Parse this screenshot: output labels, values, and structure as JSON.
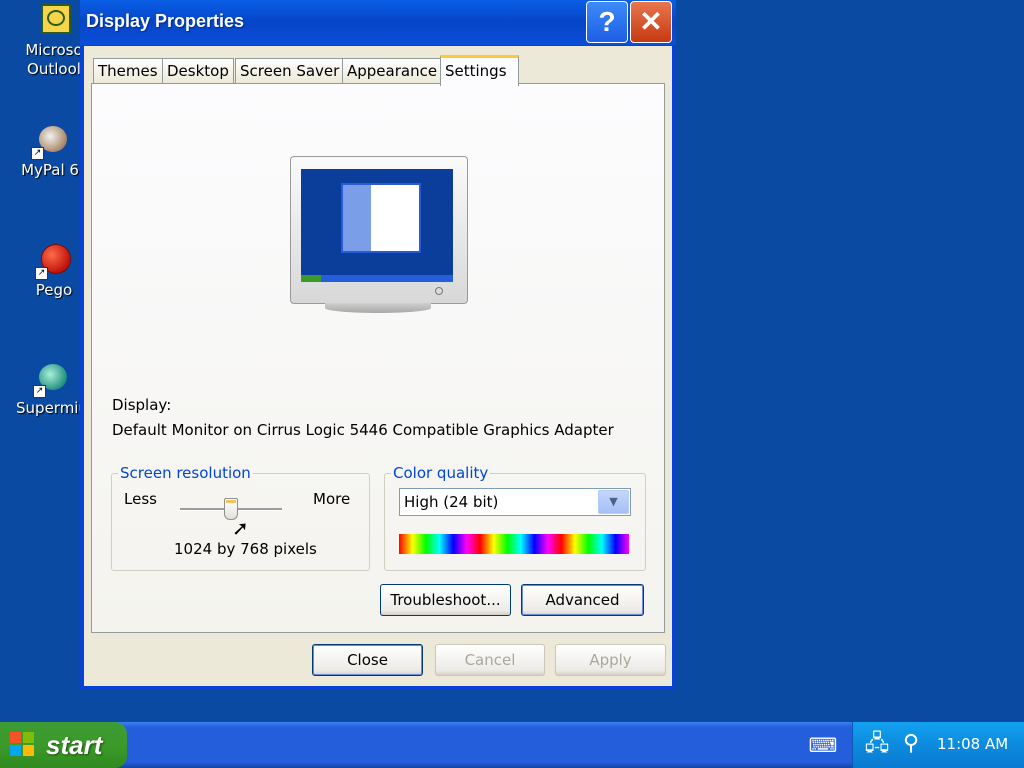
{
  "desktop": {
    "icons": [
      {
        "label": "Microso",
        "label2": "Outlool"
      },
      {
        "label": "MyPal 6"
      },
      {
        "label": "Pego"
      },
      {
        "label": "Supermiu"
      }
    ]
  },
  "window": {
    "title": "Display Properties",
    "help_glyph": "?",
    "close_glyph": "✕",
    "tabs": [
      {
        "label": "Themes"
      },
      {
        "label": "Desktop"
      },
      {
        "label": "Screen Saver"
      },
      {
        "label": "Appearance"
      },
      {
        "label": "Settings"
      }
    ],
    "active_tab": "Settings",
    "display_label": "Display:",
    "display_value": "Default Monitor on Cirrus Logic 5446 Compatible Graphics Adapter",
    "resolution": {
      "legend": "Screen resolution",
      "less": "Less",
      "more": "More",
      "value_text": "1024 by 768 pixels",
      "slider_position": 0.5
    },
    "color_quality": {
      "legend": "Color quality",
      "selected": "High (24 bit)"
    },
    "buttons": {
      "troubleshoot": "Troubleshoot...",
      "advanced": "Advanced",
      "close": "Close",
      "cancel": "Cancel",
      "apply": "Apply"
    }
  },
  "taskbar": {
    "start_label": "start",
    "clock": "11:08 AM"
  },
  "colors": {
    "desktop": "#0b4aa2",
    "title_bar": "#0a5ee6",
    "legend_text": "#0046d5",
    "start_green": "#3c9a2a"
  }
}
